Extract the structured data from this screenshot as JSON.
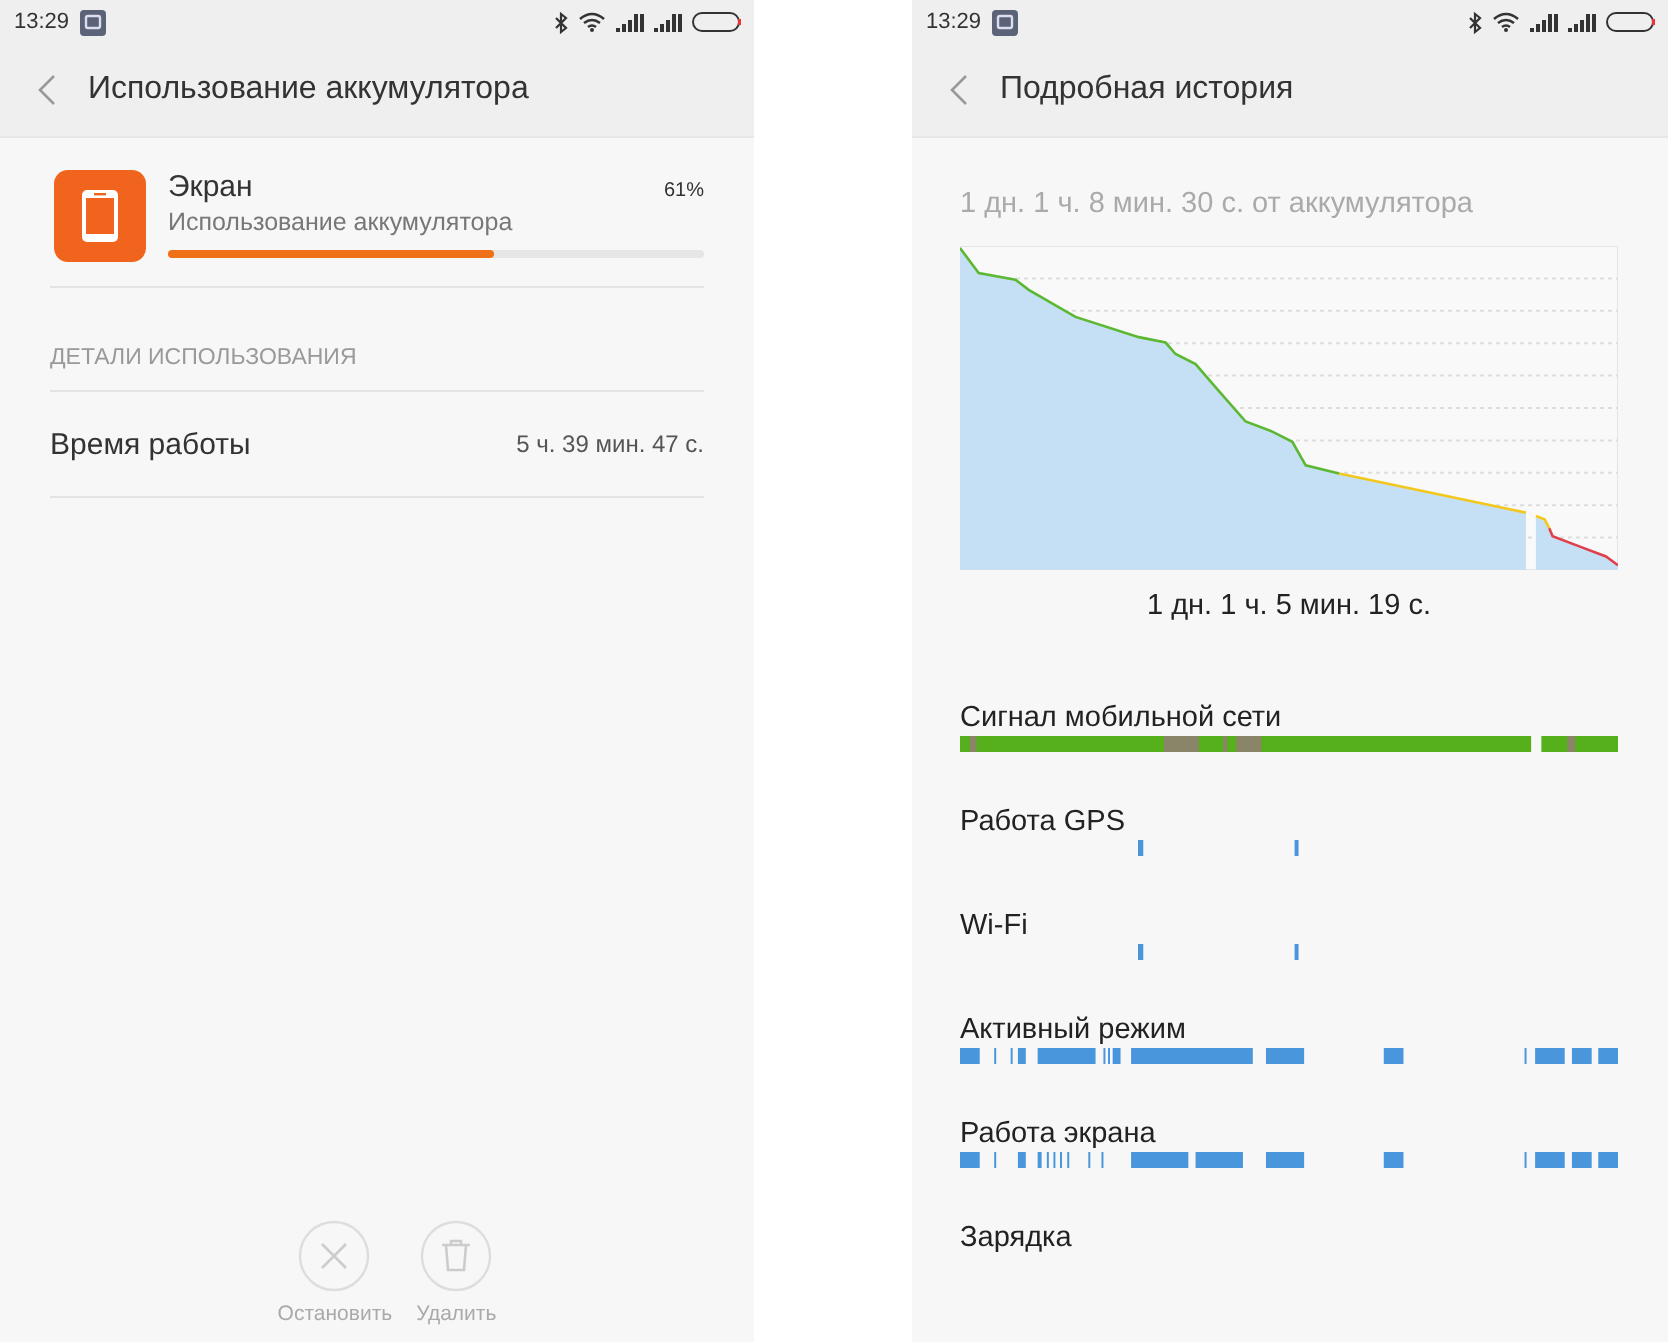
{
  "left_screen": {
    "status_bar": {
      "time": "13:29"
    },
    "header": {
      "title": "Использование аккумулятора"
    },
    "app": {
      "name": "Экран",
      "subtitle": "Использование аккумулятора",
      "percent": "61%",
      "level": 0.61
    },
    "section_heading": "ДЕТАЛИ ИСПОЛЬЗОВАНИЯ",
    "details": [
      {
        "label": "Время работы",
        "value": "5 ч. 39 мин. 47 с."
      }
    ],
    "actions": [
      {
        "kind": "stop",
        "label": "Остановить"
      },
      {
        "kind": "delete",
        "label": "Удалить"
      }
    ]
  },
  "right_screen": {
    "status_bar": {
      "time": "13:29"
    },
    "header": {
      "title": "Подробная история"
    },
    "summary": "1 дн. 1 ч. 8 мин. 30 с. от аккумулятора",
    "chart_caption": "1 дн. 1 ч. 5 мин. 19 с.",
    "tracks": [
      {
        "kind": "signal",
        "label": "Сигнал мобильной сети"
      },
      {
        "kind": "gps",
        "label": "Работа GPS"
      },
      {
        "kind": "wifi",
        "label": "Wi-Fi"
      },
      {
        "kind": "awake",
        "label": "Активный режим"
      },
      {
        "kind": "screen",
        "label": "Работа экрана"
      },
      {
        "kind": "charging",
        "label": "Зарядка"
      }
    ]
  }
}
